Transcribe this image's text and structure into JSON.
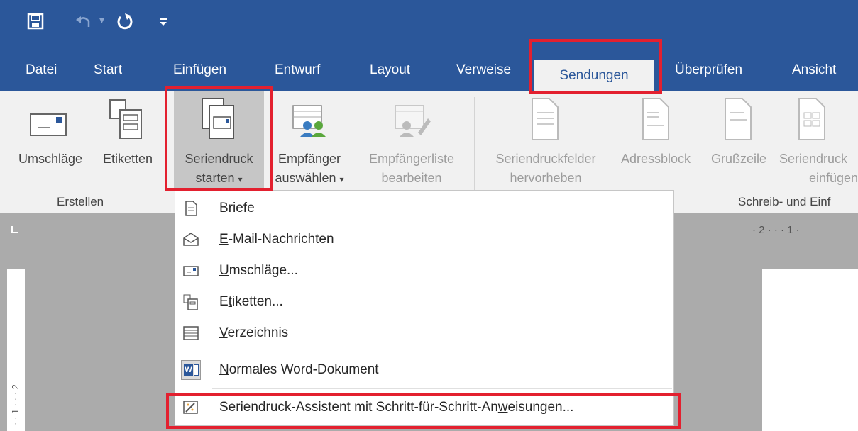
{
  "qat": {
    "save_icon": "save-icon",
    "undo_icon": "undo-icon",
    "redo_icon": "repeat-icon",
    "customize_icon": "customize-qat-icon"
  },
  "tabs": [
    {
      "label": "Datei"
    },
    {
      "label": "Start"
    },
    {
      "label": "Einfügen"
    },
    {
      "label": "Entwurf"
    },
    {
      "label": "Layout"
    },
    {
      "label": "Verweise"
    },
    {
      "label": "Sendungen",
      "active": true
    },
    {
      "label": "Überprüfen"
    },
    {
      "label": "Ansicht"
    }
  ],
  "ribbon": {
    "umschlaege": "Umschläge",
    "etiketten": "Etiketten",
    "seriendruck_l1": "Seriendruck",
    "seriendruck_l2": "starten",
    "empfaenger_l1": "Empfänger",
    "empfaenger_l2": "auswählen",
    "empfliste_l1": "Empfängerliste",
    "empfliste_l2": "bearbeiten",
    "felder_l1": "Seriendruckfelder",
    "felder_l2": "hervorheben",
    "adressblock": "Adressblock",
    "grusszeile": "Grußzeile",
    "einfuegen_l1": "Seriendruck",
    "einfuegen_l2": "einfügen",
    "group_erstellen": "Erstellen",
    "group_schreib": "Schreib- und Einf"
  },
  "ruler": {
    "horizontal": "· 2 · · · 1 ·",
    "vertical": "· · 1 · · · 2"
  },
  "menu": {
    "items": [
      {
        "pre": "",
        "ul": "B",
        "post": "riefe",
        "icon": "letter-icon"
      },
      {
        "pre": "",
        "ul": "E",
        "post": "-Mail-Nachrichten",
        "icon": "envelope-open-icon"
      },
      {
        "pre": "",
        "ul": "U",
        "post": "mschläge...",
        "icon": "envelope-icon"
      },
      {
        "pre": "E",
        "ul": "t",
        "post": "iketten...",
        "icon": "labels-icon"
      },
      {
        "pre": "",
        "ul": "V",
        "post": "erzeichnis",
        "icon": "directory-icon"
      },
      {
        "pre": "",
        "ul": "N",
        "post": "ormales Word-Dokument",
        "icon": "word-doc-icon"
      },
      {
        "pre": "Seriendruck-Assistent mit Schritt-für-Schritt-An",
        "ul": "w",
        "post": "eisungen...",
        "icon": "wizard-icon"
      }
    ]
  },
  "colors": {
    "ribbon_blue": "#2b579a",
    "highlight_red": "#e3202f",
    "ribbon_bg": "#f1f1f1"
  }
}
